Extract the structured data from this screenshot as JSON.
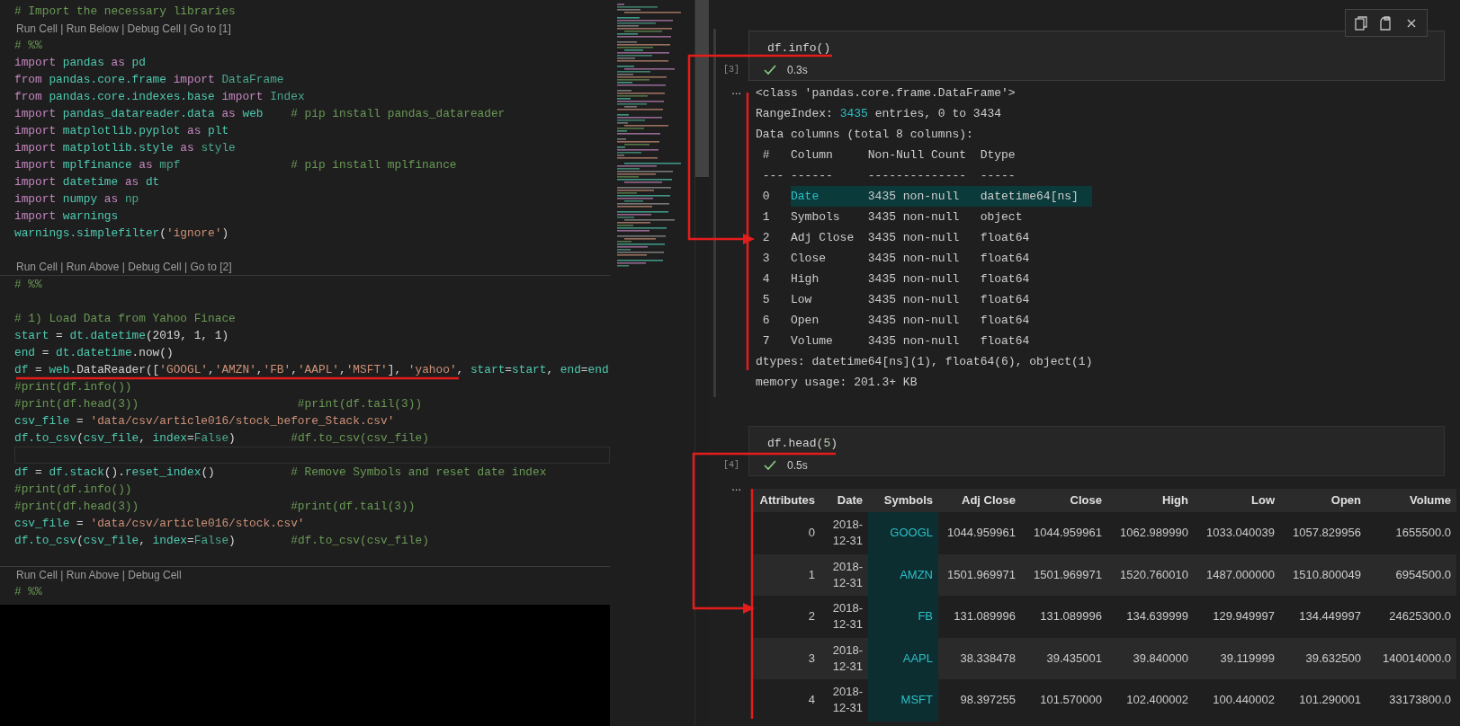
{
  "editor": {
    "lines": [
      {
        "kind": "code",
        "tokens": [
          {
            "text": "# Import the necessary libraries",
            "kind": "comment"
          }
        ]
      },
      {
        "kind": "codelens",
        "text": "Run Cell | Run Below | Debug Cell | Go to [1]",
        "rule_above": false,
        "rule_below": false
      },
      {
        "kind": "code",
        "tokens": [
          {
            "text": "# %%",
            "kind": "comment"
          }
        ]
      },
      {
        "kind": "code",
        "tokens": [
          {
            "text": "import ",
            "kind": "kw"
          },
          {
            "text": "pandas ",
            "kind": "name"
          },
          {
            "text": "as ",
            "kind": "kw"
          },
          {
            "text": "pd",
            "kind": "name"
          }
        ]
      },
      {
        "kind": "code",
        "tokens": [
          {
            "text": "from ",
            "kind": "kw"
          },
          {
            "text": "pandas.core.frame ",
            "kind": "name"
          },
          {
            "text": "import ",
            "kind": "kw"
          },
          {
            "text": "DataFrame",
            "kind": "type"
          }
        ]
      },
      {
        "kind": "code",
        "tokens": [
          {
            "text": "from ",
            "kind": "kw"
          },
          {
            "text": "pandas.core.indexes.base ",
            "kind": "name"
          },
          {
            "text": "import ",
            "kind": "kw"
          },
          {
            "text": "Index",
            "kind": "type"
          }
        ]
      },
      {
        "kind": "code",
        "tokens": [
          {
            "text": "import ",
            "kind": "kw"
          },
          {
            "text": "pandas_datareader.data ",
            "kind": "name"
          },
          {
            "text": "as ",
            "kind": "kw"
          },
          {
            "text": "web",
            "kind": "name"
          },
          {
            "text": "    # pip install pandas_datareader",
            "kind": "comment"
          }
        ]
      },
      {
        "kind": "code",
        "tokens": [
          {
            "text": "import ",
            "kind": "kw"
          },
          {
            "text": "matplotlib.pyplot ",
            "kind": "name"
          },
          {
            "text": "as ",
            "kind": "kw"
          },
          {
            "text": "plt",
            "kind": "name"
          }
        ]
      },
      {
        "kind": "code",
        "tokens": [
          {
            "text": "import ",
            "kind": "kw"
          },
          {
            "text": "matplotlib.style ",
            "kind": "name"
          },
          {
            "text": "as ",
            "kind": "kw"
          },
          {
            "text": "style",
            "kind": "type"
          }
        ]
      },
      {
        "kind": "code",
        "tokens": [
          {
            "text": "import ",
            "kind": "kw"
          },
          {
            "text": "mplfinance ",
            "kind": "name"
          },
          {
            "text": "as ",
            "kind": "kw"
          },
          {
            "text": "mpf",
            "kind": "type"
          },
          {
            "text": "                # pip install mplfinance",
            "kind": "comment"
          }
        ]
      },
      {
        "kind": "code",
        "tokens": [
          {
            "text": "import ",
            "kind": "kw"
          },
          {
            "text": "datetime ",
            "kind": "name"
          },
          {
            "text": "as ",
            "kind": "kw"
          },
          {
            "text": "dt",
            "kind": "name"
          }
        ]
      },
      {
        "kind": "code",
        "tokens": [
          {
            "text": "import ",
            "kind": "kw"
          },
          {
            "text": "numpy ",
            "kind": "name"
          },
          {
            "text": "as ",
            "kind": "kw"
          },
          {
            "text": "np",
            "kind": "type"
          }
        ]
      },
      {
        "kind": "code",
        "tokens": [
          {
            "text": "import ",
            "kind": "kw"
          },
          {
            "text": "warnings",
            "kind": "name"
          }
        ]
      },
      {
        "kind": "code",
        "tokens": [
          {
            "text": "warnings.simplefilter",
            "kind": "name"
          },
          {
            "text": "(",
            "kind": "plain"
          },
          {
            "text": "'ignore'",
            "kind": "string"
          },
          {
            "text": ")",
            "kind": "plain"
          }
        ]
      },
      {
        "kind": "blank"
      },
      {
        "kind": "codelens",
        "text": "Run Cell | Run Above | Debug Cell | Go to [2]",
        "rule_above": false,
        "rule_below": true
      },
      {
        "kind": "code",
        "tokens": [
          {
            "text": "# %%",
            "kind": "comment"
          }
        ]
      },
      {
        "kind": "blank"
      },
      {
        "kind": "code",
        "tokens": [
          {
            "text": "# 1) Load Data from Yahoo Finace",
            "kind": "comment"
          }
        ]
      },
      {
        "kind": "code",
        "tokens": [
          {
            "text": "start",
            "kind": "name"
          },
          {
            "text": " = ",
            "kind": "plain"
          },
          {
            "text": "dt.datetime",
            "kind": "name"
          },
          {
            "text": "(2019, 1, 1)",
            "kind": "plain"
          }
        ]
      },
      {
        "kind": "code",
        "tokens": [
          {
            "text": "end",
            "kind": "name"
          },
          {
            "text": " = ",
            "kind": "plain"
          },
          {
            "text": "dt.datetime",
            "kind": "name"
          },
          {
            "text": ".now()",
            "kind": "plain"
          }
        ]
      },
      {
        "kind": "code",
        "tokens": [
          {
            "text": "df",
            "kind": "name"
          },
          {
            "text": " = ",
            "kind": "plain"
          },
          {
            "text": "web",
            "kind": "name"
          },
          {
            "text": ".DataReader([",
            "kind": "plain"
          },
          {
            "text": "'GOOGL'",
            "kind": "string"
          },
          {
            "text": ",",
            "kind": "plain"
          },
          {
            "text": "'AMZN'",
            "kind": "string"
          },
          {
            "text": ",",
            "kind": "plain"
          },
          {
            "text": "'FB'",
            "kind": "string"
          },
          {
            "text": ",",
            "kind": "plain"
          },
          {
            "text": "'AAPL'",
            "kind": "string"
          },
          {
            "text": ",",
            "kind": "plain"
          },
          {
            "text": "'MSFT'",
            "kind": "string"
          },
          {
            "text": "], ",
            "kind": "plain"
          },
          {
            "text": "'yahoo'",
            "kind": "string"
          },
          {
            "text": ", ",
            "kind": "plain"
          },
          {
            "text": "start",
            "kind": "name"
          },
          {
            "text": "=",
            "kind": "plain"
          },
          {
            "text": "start",
            "kind": "name"
          },
          {
            "text": ", ",
            "kind": "plain"
          },
          {
            "text": "end",
            "kind": "name"
          },
          {
            "text": "=",
            "kind": "plain"
          },
          {
            "text": "end",
            "kind": "name"
          }
        ]
      },
      {
        "kind": "code",
        "tokens": [
          {
            "text": "#print(df.info())",
            "kind": "comment"
          }
        ]
      },
      {
        "kind": "code",
        "tokens": [
          {
            "text": "#print(df.head(3))                       #print(df.tail(3))",
            "kind": "comment"
          }
        ]
      },
      {
        "kind": "code",
        "tokens": [
          {
            "text": "csv_file",
            "kind": "name"
          },
          {
            "text": " = ",
            "kind": "plain"
          },
          {
            "text": "'data/csv/article016/stock_before_Stack.csv'",
            "kind": "string"
          }
        ]
      },
      {
        "kind": "code",
        "tokens": [
          {
            "text": "df.to_csv",
            "kind": "name"
          },
          {
            "text": "(",
            "kind": "plain"
          },
          {
            "text": "csv_file",
            "kind": "name"
          },
          {
            "text": ", ",
            "kind": "plain"
          },
          {
            "text": "index",
            "kind": "name"
          },
          {
            "text": "=",
            "kind": "plain"
          },
          {
            "text": "False",
            "kind": "type"
          },
          {
            "text": ")",
            "kind": "plain"
          },
          {
            "text": "        #df.to_csv(csv_file)",
            "kind": "comment"
          }
        ]
      },
      {
        "kind": "current_blank"
      },
      {
        "kind": "code",
        "tokens": [
          {
            "text": "df",
            "kind": "name"
          },
          {
            "text": " = ",
            "kind": "plain"
          },
          {
            "text": "df.stack",
            "kind": "name"
          },
          {
            "text": "().",
            "kind": "plain"
          },
          {
            "text": "reset_index",
            "kind": "name"
          },
          {
            "text": "()",
            "kind": "plain"
          },
          {
            "text": "           # Remove Symbols and reset date index",
            "kind": "comment"
          }
        ]
      },
      {
        "kind": "code",
        "tokens": [
          {
            "text": "#print(df.info())",
            "kind": "comment"
          }
        ]
      },
      {
        "kind": "code",
        "tokens": [
          {
            "text": "#print(df.head(3))                      #print(df.tail(3))",
            "kind": "comment"
          }
        ]
      },
      {
        "kind": "code",
        "tokens": [
          {
            "text": "csv_file",
            "kind": "name"
          },
          {
            "text": " = ",
            "kind": "plain"
          },
          {
            "text": "'data/csv/article016/stock.csv'",
            "kind": "string"
          }
        ]
      },
      {
        "kind": "code",
        "tokens": [
          {
            "text": "df.to_csv",
            "kind": "name"
          },
          {
            "text": "(",
            "kind": "plain"
          },
          {
            "text": "csv_file",
            "kind": "name"
          },
          {
            "text": ", ",
            "kind": "plain"
          },
          {
            "text": "index",
            "kind": "name"
          },
          {
            "text": "=",
            "kind": "plain"
          },
          {
            "text": "False",
            "kind": "type"
          },
          {
            "text": ")",
            "kind": "plain"
          },
          {
            "text": "        #df.to_csv(csv_file)",
            "kind": "comment"
          }
        ]
      },
      {
        "kind": "blank"
      },
      {
        "kind": "codelens",
        "text": "Run Cell | Run Above | Debug Cell",
        "rule_above": true,
        "rule_below": false
      },
      {
        "kind": "code",
        "tokens": [
          {
            "text": "# %%",
            "kind": "comment"
          }
        ]
      }
    ]
  },
  "notebook": {
    "cells": [
      {
        "focused": true,
        "code": [
          {
            "text": "df.info()",
            "kind": "plain"
          }
        ],
        "count": "[3]",
        "succeeded": true,
        "duration": "0.3s",
        "output_menu": "...",
        "output": {
          "kind": "text",
          "lines": [
            {
              "kind": "text",
              "tokens": [
                {
                  "text": "<class 'pandas.core.frame.DataFrame'>",
                  "kind": "plain"
                }
              ]
            },
            {
              "kind": "text",
              "tokens": [
                {
                  "text": "RangeIndex: ",
                  "kind": "plain"
                },
                {
                  "text": "3435",
                  "kind": "number"
                },
                {
                  "text": " entries, 0 to 3434",
                  "kind": "plain"
                }
              ]
            },
            {
              "kind": "text",
              "tokens": [
                {
                  "text": "Data columns (total 8 columns):",
                  "kind": "plain"
                }
              ]
            },
            {
              "kind": "columns",
              "cells": [
                "#",
                "Column",
                "Non-Null Count",
                "Dtype"
              ],
              "highlighted": false
            },
            {
              "kind": "columns",
              "cells": [
                "---",
                "------",
                "--------------",
                "-----"
              ],
              "highlighted": false
            },
            {
              "kind": "columns",
              "cells": [
                "0",
                "Date",
                "3435 non-null",
                "datetime64[ns]"
              ],
              "highlighted": true
            },
            {
              "kind": "columns",
              "cells": [
                "1",
                "Symbols",
                "3435 non-null",
                "object"
              ],
              "highlighted": false
            },
            {
              "kind": "columns",
              "cells": [
                "2",
                "Adj Close",
                "3435 non-null",
                "float64"
              ],
              "highlighted": false
            },
            {
              "kind": "columns",
              "cells": [
                "3",
                "Close",
                "3435 non-null",
                "float64"
              ],
              "highlighted": false
            },
            {
              "kind": "columns",
              "cells": [
                "4",
                "High",
                "3435 non-null",
                "float64"
              ],
              "highlighted": false
            },
            {
              "kind": "columns",
              "cells": [
                "5",
                "Low",
                "3435 non-null",
                "float64"
              ],
              "highlighted": false
            },
            {
              "kind": "columns",
              "cells": [
                "6",
                "Open",
                "3435 non-null",
                "float64"
              ],
              "highlighted": false
            },
            {
              "kind": "columns",
              "cells": [
                "7",
                "Volume",
                "3435 non-null",
                "float64"
              ],
              "highlighted": false
            },
            {
              "kind": "text",
              "tokens": [
                {
                  "text": "dtypes: datetime64[ns](1), float64(6), object(1)",
                  "kind": "plain"
                }
              ]
            },
            {
              "kind": "text",
              "tokens": [
                {
                  "text": "memory usage: 201.3+ KB",
                  "kind": "plain"
                }
              ]
            }
          ]
        }
      },
      {
        "focused": false,
        "code": [
          {
            "text": "df.head(",
            "kind": "plain"
          },
          {
            "text": "5",
            "kind": "number"
          },
          {
            "text": ")",
            "kind": "plain"
          }
        ],
        "count": "[4]",
        "succeeded": true,
        "duration": "0.5s",
        "output_menu": "...",
        "output": {
          "kind": "table",
          "columns": [
            {
              "label": "Attributes",
              "highlighted": false
            },
            {
              "label": "Date",
              "highlighted": false
            },
            {
              "label": "Symbols",
              "highlighted": true
            },
            {
              "label": "Adj Close",
              "highlighted": false
            },
            {
              "label": "Close",
              "highlighted": false
            },
            {
              "label": "High",
              "highlighted": false
            },
            {
              "label": "Low",
              "highlighted": false
            },
            {
              "label": "Open",
              "highlighted": false
            },
            {
              "label": "Volume",
              "highlighted": false
            }
          ],
          "rows": [
            [
              "0",
              "2018-12-31",
              "GOOGL",
              "1044.959961",
              "1044.959961",
              "1062.989990",
              "1033.040039",
              "1057.829956",
              "1655500.0"
            ],
            [
              "1",
              "2018-12-31",
              "AMZN",
              "1501.969971",
              "1501.969971",
              "1520.760010",
              "1487.000000",
              "1510.800049",
              "6954500.0"
            ],
            [
              "2",
              "2018-12-31",
              "FB",
              "131.089996",
              "131.089996",
              "134.639999",
              "129.949997",
              "134.449997",
              "24625300.0"
            ],
            [
              "3",
              "2018-12-31",
              "AAPL",
              "38.338478",
              "39.435001",
              "39.840000",
              "39.119999",
              "39.632500",
              "140014000.0"
            ],
            [
              "4",
              "2018-12-31",
              "MSFT",
              "98.397255",
              "101.570000",
              "102.400002",
              "100.440002",
              "101.290001",
              "33173800.0"
            ]
          ]
        }
      }
    ]
  }
}
